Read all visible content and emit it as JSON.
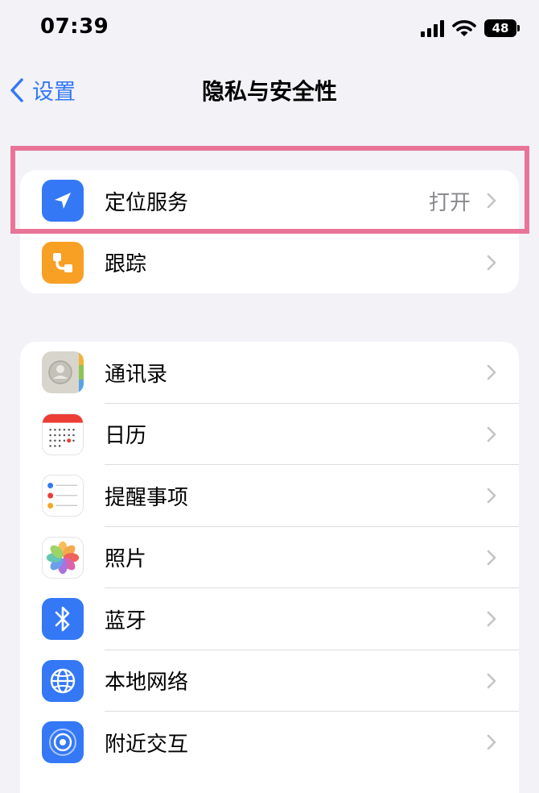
{
  "status_bar": {
    "time": "07:39",
    "battery": "48",
    "icons": [
      "signal-icon",
      "wifi-icon",
      "battery-icon"
    ]
  },
  "nav": {
    "back_label": "设置",
    "title": "隐私与安全性"
  },
  "colors": {
    "accent": "#3478f6",
    "background": "#f2f2f7",
    "highlight": "#ea7498"
  },
  "group1": [
    {
      "label": "定位服务",
      "value": "打开",
      "icon": "location-arrow-icon",
      "color": "#3478f6"
    },
    {
      "label": "跟踪",
      "icon": "tracking-icon",
      "color": "#f7a024"
    }
  ],
  "group2": [
    {
      "label": "通讯录",
      "icon": "contacts-icon"
    },
    {
      "label": "日历",
      "icon": "calendar-icon"
    },
    {
      "label": "提醒事项",
      "icon": "reminders-icon"
    },
    {
      "label": "照片",
      "icon": "photos-icon"
    },
    {
      "label": "蓝牙",
      "icon": "bluetooth-icon",
      "color": "#3478f6"
    },
    {
      "label": "本地网络",
      "icon": "globe-icon",
      "color": "#3478f6"
    },
    {
      "label": "附近交互",
      "icon": "nearby-interaction-icon",
      "color": "#3478f6"
    }
  ]
}
